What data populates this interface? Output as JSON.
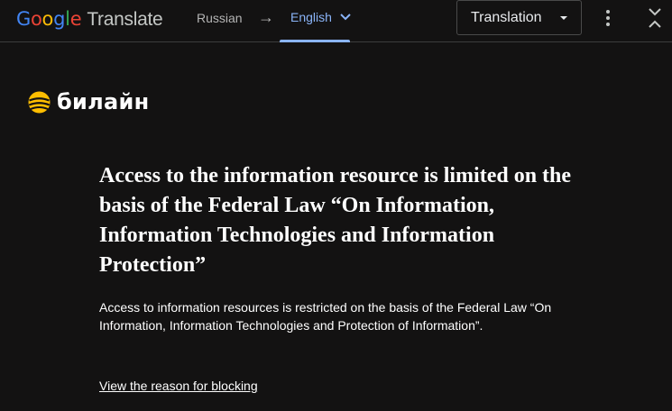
{
  "toolbar": {
    "logo": {
      "google_letters": [
        "G",
        "o",
        "o",
        "g",
        "l",
        "e"
      ],
      "product": "Translate"
    },
    "source_language": "Russian",
    "arrow": "→",
    "target_language": "English",
    "view_mode": "Translation",
    "icons": {
      "target_dropdown": "chevron-down-icon",
      "view_dropdown": "caret-down-icon",
      "more": "more-vert-icon",
      "collapse": "collapse-icon"
    },
    "colors": {
      "accent": "#8ab4f8",
      "google_blue": "#4285f4",
      "google_red": "#ea4335",
      "google_yellow": "#fbbc05",
      "google_green": "#34a853"
    }
  },
  "page": {
    "brand": {
      "name": "билайн",
      "logo_colors": [
        "#ffbe00",
        "#131212"
      ]
    },
    "headline": "Access to the information resource is limited on the basis of the Federal Law “On Information, Information Technologies and Information Protection”",
    "body": "Access to information resources is restricted on the basis of the Federal Law “On Information, Information Technologies and Protection of Information”.",
    "link": "View the reason for blocking",
    "background": "#131212"
  }
}
